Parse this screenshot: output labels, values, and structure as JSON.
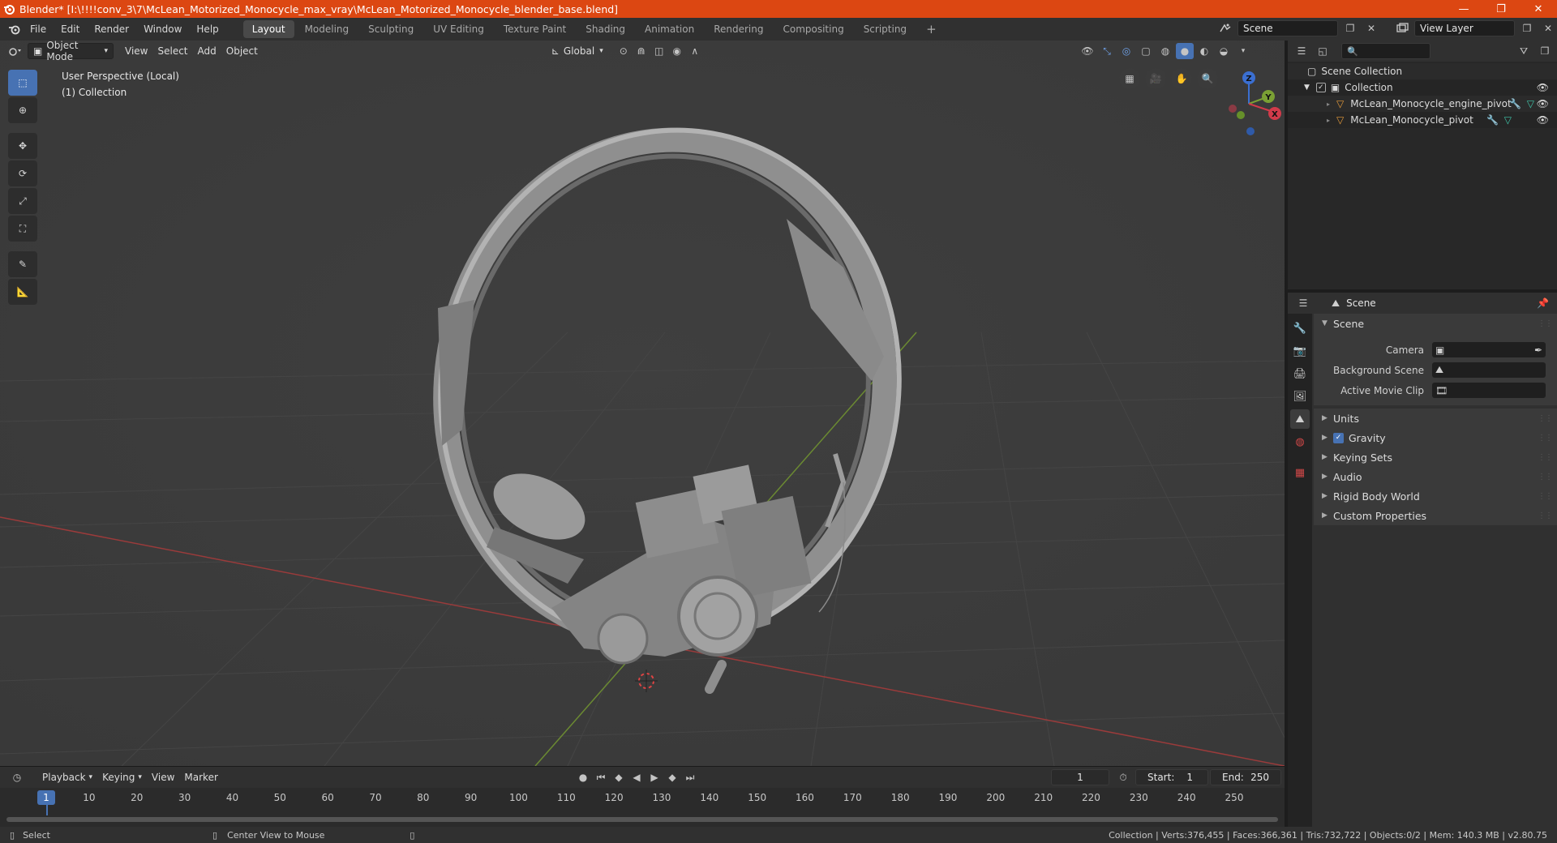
{
  "window": {
    "title": "Blender* [I:\\!!!!conv_3\\7\\McLean_Motorized_Monocycle_max_vray\\McLean_Motorized_Monocycle_blender_base.blend]",
    "minimize": "—",
    "restore": "❐",
    "close": "✕"
  },
  "menu": [
    "File",
    "Edit",
    "Render",
    "Window",
    "Help"
  ],
  "workspaces": [
    "Layout",
    "Modeling",
    "Sculpting",
    "UV Editing",
    "Texture Paint",
    "Shading",
    "Animation",
    "Rendering",
    "Compositing",
    "Scripting"
  ],
  "add_workspace": "+",
  "scene_selector": {
    "value": "Scene"
  },
  "view_layer_selector": {
    "value": "View Layer"
  },
  "viewport": {
    "mode": "Object Mode",
    "menus": [
      "View",
      "Select",
      "Add",
      "Object"
    ],
    "transform_orientation": "Global",
    "info_line1": "User Perspective (Local)",
    "info_line2": "(1) Collection",
    "gizmo_axes": {
      "z": "Z",
      "y": "Y",
      "x": "X"
    }
  },
  "outliner": {
    "search_placeholder": "",
    "root": "Scene Collection",
    "collection": "Collection",
    "objects": [
      "McLean_Monocycle_engine_pivot",
      "McLean_Monocycle_pivot"
    ]
  },
  "properties": {
    "context": "Scene",
    "panel_title": "Scene",
    "fields": [
      {
        "label": "Camera",
        "value": ""
      },
      {
        "label": "Background Scene",
        "value": ""
      },
      {
        "label": "Active Movie Clip",
        "value": ""
      }
    ],
    "sections": [
      "Units",
      "Gravity",
      "Keying Sets",
      "Audio",
      "Rigid Body World",
      "Custom Properties"
    ],
    "gravity_checked": true
  },
  "timeline": {
    "menus": [
      "Playback",
      "Keying",
      "View",
      "Marker"
    ],
    "current_frame": "1",
    "start_label": "Start:",
    "start": "1",
    "end_label": "End:",
    "end": "250",
    "ruler_ticks": [
      "1",
      "10",
      "20",
      "30",
      "40",
      "50",
      "60",
      "70",
      "80",
      "90",
      "100",
      "110",
      "120",
      "130",
      "140",
      "150",
      "160",
      "170",
      "180",
      "190",
      "200",
      "210",
      "220",
      "230",
      "240",
      "250"
    ]
  },
  "statusbar": {
    "left_action": "Select",
    "middle_action": "Center View to Mouse",
    "stats": "Collection | Verts:376,455 | Faces:366,361 | Tris:732,722 | Objects:0/2 | Mem: 140.3 MB | v2.80.75"
  }
}
